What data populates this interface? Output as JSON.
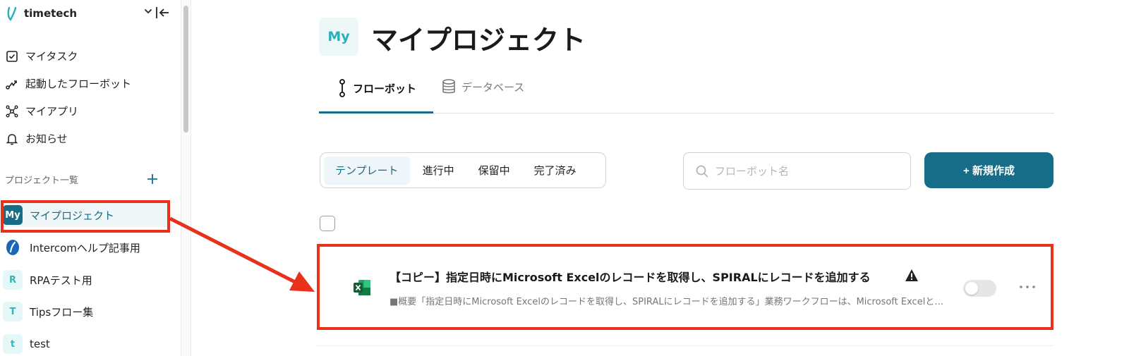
{
  "sidebar": {
    "workspace_name": "timetech",
    "nav": [
      {
        "label": "マイタスク",
        "icon": "checkbox-icon"
      },
      {
        "label": "起動したフローボット",
        "icon": "flow-icon"
      },
      {
        "label": "マイアプリ",
        "icon": "apps-icon"
      },
      {
        "label": "お知らせ",
        "icon": "bell-icon"
      }
    ],
    "projects_label": "プロジェクト一覧",
    "projects": [
      {
        "badge": "My",
        "label": "マイプロジェクト",
        "active": true
      },
      {
        "badge": "",
        "label": "Intercomヘルプ記事用",
        "active": false
      },
      {
        "badge": "R",
        "label": "RPAテスト用",
        "active": false
      },
      {
        "badge": "T",
        "label": "Tipsフロー集",
        "active": false
      },
      {
        "badge": "t",
        "label": "test",
        "active": false
      }
    ]
  },
  "main": {
    "page_badge": "My",
    "page_title": "マイプロジェクト",
    "tabs": [
      {
        "label": "フローボット",
        "active": true
      },
      {
        "label": "データベース",
        "active": false
      }
    ],
    "filters": [
      "テンプレート",
      "進行中",
      "保留中",
      "完了済み"
    ],
    "active_filter": "テンプレート",
    "search_placeholder": "フローボット名",
    "new_button": "+ 新規作成",
    "flowbots": [
      {
        "title": "【コピー】指定日時にMicrosoft Excelのレコードを取得し、SPIRALにレコードを追加する",
        "description": "■概要「指定日時にMicrosoft Excelのレコードを取得し、SPIRALにレコードを追加する」業務ワークフローは、Microsoft Excelと…",
        "app_icon": "excel-icon",
        "warning": true,
        "enabled": false
      }
    ]
  },
  "colors": {
    "accent": "#176d87",
    "highlight": "#e8301a"
  }
}
